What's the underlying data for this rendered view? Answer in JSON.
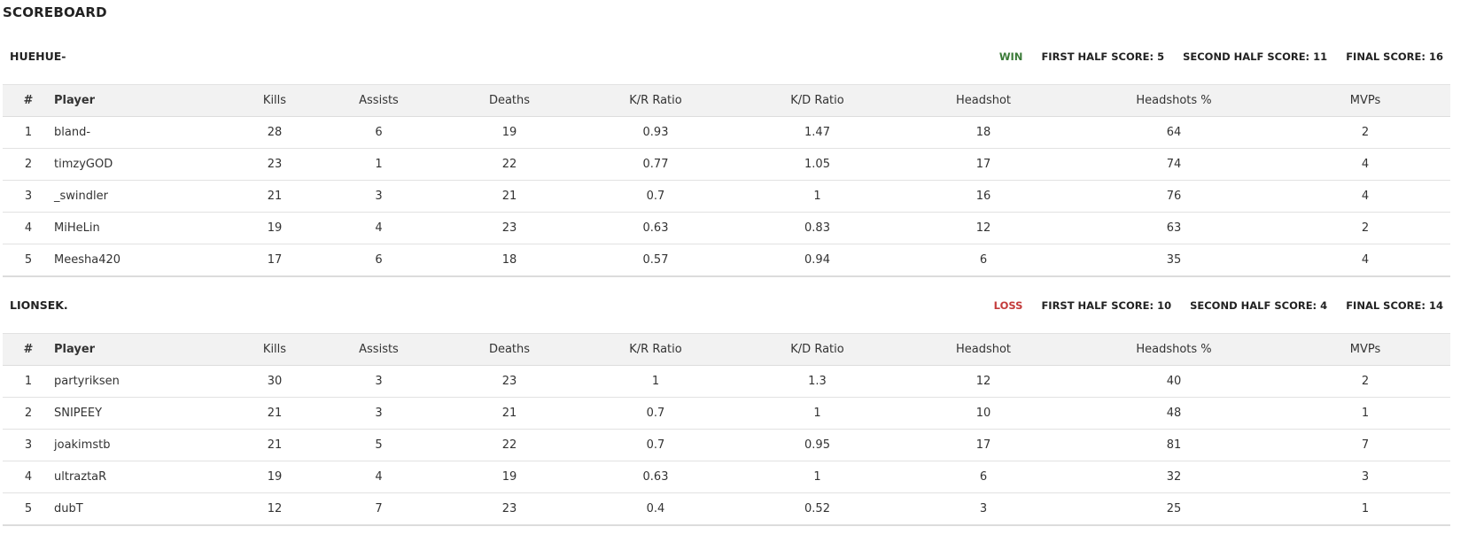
{
  "page": {
    "title": "SCOREBOARD"
  },
  "columns": [
    "#",
    "Player",
    "Kills",
    "Assists",
    "Deaths",
    "K/R Ratio",
    "K/D Ratio",
    "Headshot",
    "Headshots %",
    "MVPs"
  ],
  "colors": {
    "win": "#3a7a37",
    "loss": "#c43b3b",
    "header_bg": "#f2f2f2"
  },
  "teams": [
    {
      "name": "HUEHUE-",
      "result": "WIN",
      "first_half": "FIRST HALF SCORE: 5",
      "second_half": "SECOND HALF SCORE: 11",
      "final": "FINAL SCORE: 16",
      "players": [
        [
          "1",
          "bland-",
          "28",
          "6",
          "19",
          "0.93",
          "1.47",
          "18",
          "64",
          "2"
        ],
        [
          "2",
          "timzyGOD",
          "23",
          "1",
          "22",
          "0.77",
          "1.05",
          "17",
          "74",
          "4"
        ],
        [
          "3",
          "_swindler",
          "21",
          "3",
          "21",
          "0.7",
          "1",
          "16",
          "76",
          "4"
        ],
        [
          "4",
          "MiHeLin",
          "19",
          "4",
          "23",
          "0.63",
          "0.83",
          "12",
          "63",
          "2"
        ],
        [
          "5",
          "Meesha420",
          "17",
          "6",
          "18",
          "0.57",
          "0.94",
          "6",
          "35",
          "4"
        ]
      ]
    },
    {
      "name": "LIONSEK.",
      "result": "LOSS",
      "first_half": "FIRST HALF SCORE: 10",
      "second_half": "SECOND HALF SCORE: 4",
      "final": "FINAL SCORE: 14",
      "players": [
        [
          "1",
          "partyriksen",
          "30",
          "3",
          "23",
          "1",
          "1.3",
          "12",
          "40",
          "2"
        ],
        [
          "2",
          "SNIPEEY",
          "21",
          "3",
          "21",
          "0.7",
          "1",
          "10",
          "48",
          "1"
        ],
        [
          "3",
          "joakimstb",
          "21",
          "5",
          "22",
          "0.7",
          "0.95",
          "17",
          "81",
          "7"
        ],
        [
          "4",
          "ultraztaR",
          "19",
          "4",
          "19",
          "0.63",
          "1",
          "6",
          "32",
          "3"
        ],
        [
          "5",
          "dubT",
          "12",
          "7",
          "23",
          "0.4",
          "0.52",
          "3",
          "25",
          "1"
        ]
      ]
    }
  ]
}
